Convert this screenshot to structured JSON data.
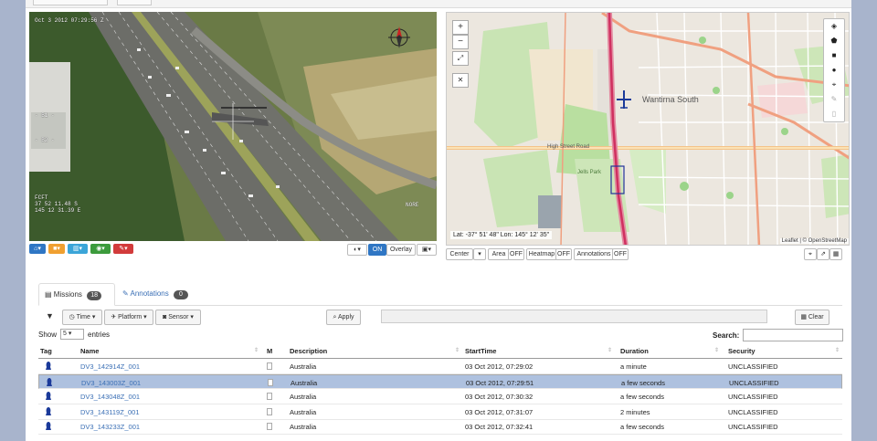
{
  "video": {
    "timestamp": "Oct 3 2012 07:29:56 Z",
    "overlay_left": "FCFT\n37 52 11.48 S\n145 12 31.39 E",
    "overlay_right": "NORE",
    "left_labels": [
      "- B1 -",
      "- B2 -"
    ],
    "toolbar": {
      "on_label": "ON",
      "overlay_label": "Overlay"
    }
  },
  "map": {
    "zoom_in": "+",
    "zoom_out": "−",
    "suburb": "Wantirna South",
    "road_high_street": "High Street Road",
    "park_label": "Jells Park",
    "coords": "Lat: -37° 51' 48\" Lon: 145° 12' 35\"",
    "attribution": "Leaflet | © OpenStreetMap",
    "toolbar": {
      "center_label": "Center",
      "area_label": "Area",
      "area_state": "OFF",
      "heatmap_label": "Heatmap",
      "heatmap_state": "OFF",
      "annotations_label": "Annotations",
      "annotations_state": "OFF"
    }
  },
  "tabs": [
    {
      "label": "Missions",
      "badge": "18"
    },
    {
      "label": "Annotations",
      "badge": "0"
    }
  ],
  "filters": {
    "time_label": "Time",
    "platform_label": "Platform",
    "sensor_label": "Sensor",
    "apply_label": "Apply",
    "clear_label": "Clear"
  },
  "table_controls": {
    "show_label": "Show",
    "entries_value": "5",
    "entries_label": "entries",
    "search_label": "Search:"
  },
  "table": {
    "headers": [
      "Tag",
      "Name",
      "M",
      "Description",
      "StartTime",
      "Duration",
      "Security"
    ],
    "rows": [
      {
        "name": "DV3_142914Z_001",
        "description": "Australia",
        "start": "03 Oct 2012, 07:29:02",
        "duration": "a minute",
        "security": "UNCLASSIFIED"
      },
      {
        "name": "DV3_143003Z_001",
        "description": "Australia",
        "start": "03 Oct 2012, 07:29:51",
        "duration": "a few seconds",
        "security": "UNCLASSIFIED"
      },
      {
        "name": "DV3_143048Z_001",
        "description": "Australia",
        "start": "03 Oct 2012, 07:30:32",
        "duration": "a few seconds",
        "security": "UNCLASSIFIED"
      },
      {
        "name": "DV3_143119Z_001",
        "description": "Australia",
        "start": "03 Oct 2012, 07:31:07",
        "duration": "2 minutes",
        "security": "UNCLASSIFIED"
      },
      {
        "name": "DV3_143233Z_001",
        "description": "Australia",
        "start": "03 Oct 2012, 07:32:41",
        "duration": "a few seconds",
        "security": "UNCLASSIFIED"
      }
    ],
    "selected_row": 1
  },
  "colors": {
    "accent": "#2f76c4",
    "selected_row": "#aec1df",
    "track_line": "#d03060"
  }
}
